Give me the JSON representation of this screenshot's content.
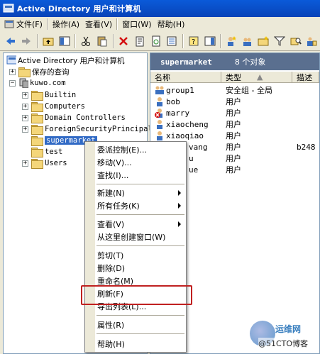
{
  "window": {
    "title": "Active Directory 用户和计算机"
  },
  "menubar": {
    "items": [
      "文件(F)",
      "操作(A)",
      "查看(V)",
      "窗口(W)",
      "帮助(H)"
    ]
  },
  "tree": {
    "root_label": "Active Directory 用户和计算机",
    "saved_queries": "保存的查询",
    "domain": "kuwo.com",
    "children": [
      "Builtin",
      "Computers",
      "Domain Controllers",
      "ForeignSecurityPrincipal",
      "supermarket",
      "test",
      "Users"
    ]
  },
  "rightpane": {
    "header_title": "supermarket",
    "header_count": "8 个对象",
    "columns": [
      "名称",
      "类型",
      "描述"
    ],
    "rows": [
      {
        "name": "group1",
        "type": "安全组 - 全局",
        "desc": ""
      },
      {
        "name": "bob",
        "type": "用户",
        "desc": ""
      },
      {
        "name": "marry",
        "type": "用户",
        "desc": ""
      },
      {
        "name": "xiaocheng",
        "type": "用户",
        "desc": ""
      },
      {
        "name": "xiaoqiao",
        "type": "用户",
        "desc": ""
      },
      {
        "name": "vang",
        "type": "用户",
        "desc": "b248"
      },
      {
        "name": "u",
        "type": "用户",
        "desc": ""
      },
      {
        "name": "ue",
        "type": "用户",
        "desc": ""
      }
    ]
  },
  "context_menu": {
    "items": [
      "委派控制(E)...",
      "移动(V)...",
      "查找(I)...",
      "新建(N)",
      "所有任务(K)",
      "查看(V)",
      "从这里创建窗口(W)",
      "剪切(T)",
      "删除(D)",
      "重命名(M)",
      "刷新(F)",
      "导出列表(L)...",
      "属性(R)",
      "帮助(H)"
    ]
  },
  "watermark": {
    "line1": "运维网",
    "line2": "@51CTO博客"
  },
  "colors": {
    "title_bar": "#0a5ad9",
    "pane_header": "#5a6f8f",
    "selection": "#316ac5",
    "highlight_box": "#c02020"
  }
}
